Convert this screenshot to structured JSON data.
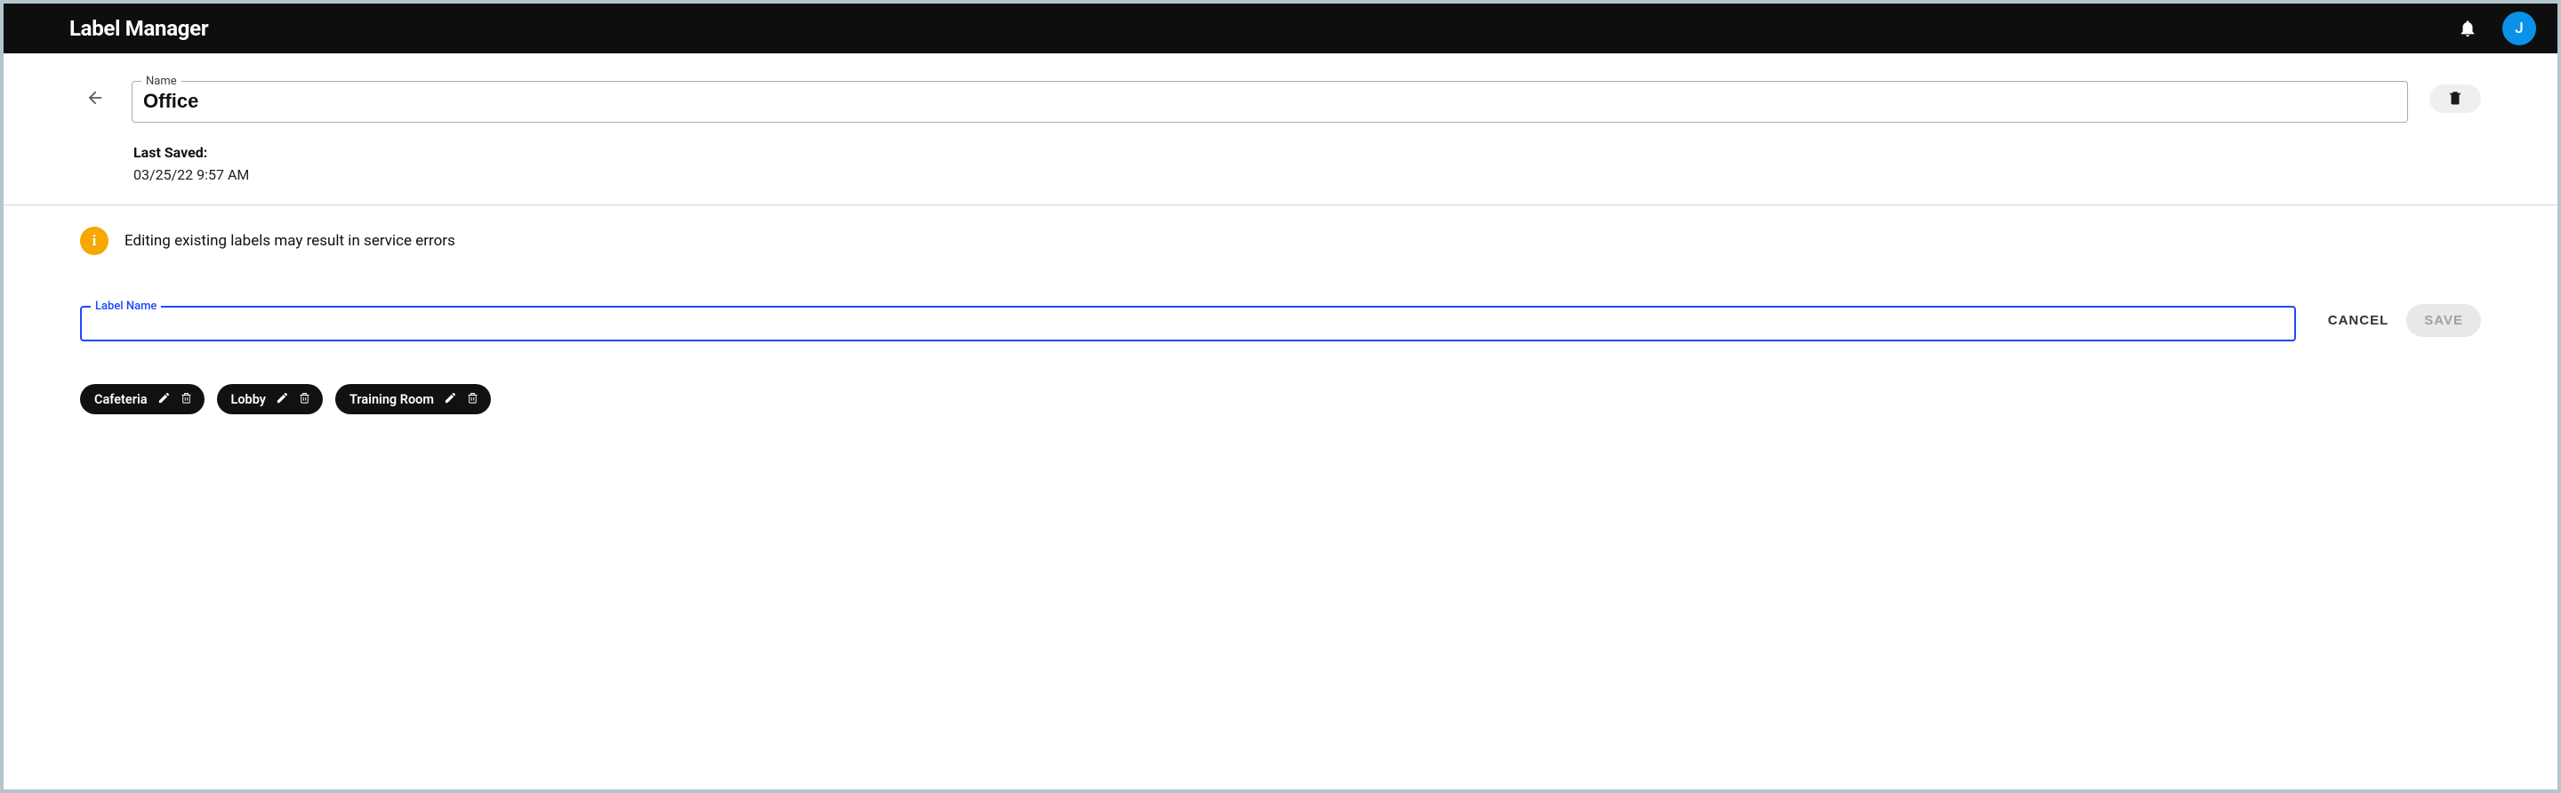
{
  "header": {
    "title": "Label Manager",
    "avatar_initial": "J"
  },
  "form": {
    "name_label": "Name",
    "name_value": "Office",
    "last_saved_label": "Last Saved:",
    "last_saved_value": "03/25/22 9:57 AM"
  },
  "banner": {
    "text": "Editing existing labels may result in service errors"
  },
  "label_form": {
    "field_label": "Label Name",
    "field_value": "",
    "cancel_label": "CANCEL",
    "save_label": "SAVE"
  },
  "chips": [
    {
      "label": "Cafeteria"
    },
    {
      "label": "Lobby"
    },
    {
      "label": "Training Room"
    }
  ]
}
